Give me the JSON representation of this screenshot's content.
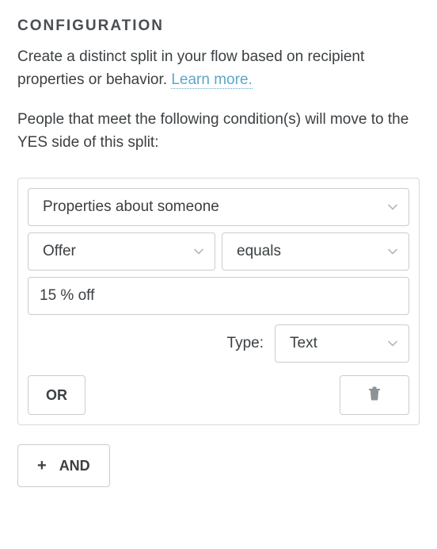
{
  "heading": "CONFIGURATION",
  "description_prefix": "Create a distinct split in your flow based on recipient properties or behavior. ",
  "learn_more": "Learn more.",
  "condition_instruction": "People that meet the following condition(s) will move to the YES side of this split:",
  "condition": {
    "source": "Properties about someone",
    "property": "Offer",
    "operator": "equals",
    "value": "15 % off",
    "type_label": "Type:",
    "type_value": "Text"
  },
  "buttons": {
    "or": "OR",
    "and": "AND"
  }
}
